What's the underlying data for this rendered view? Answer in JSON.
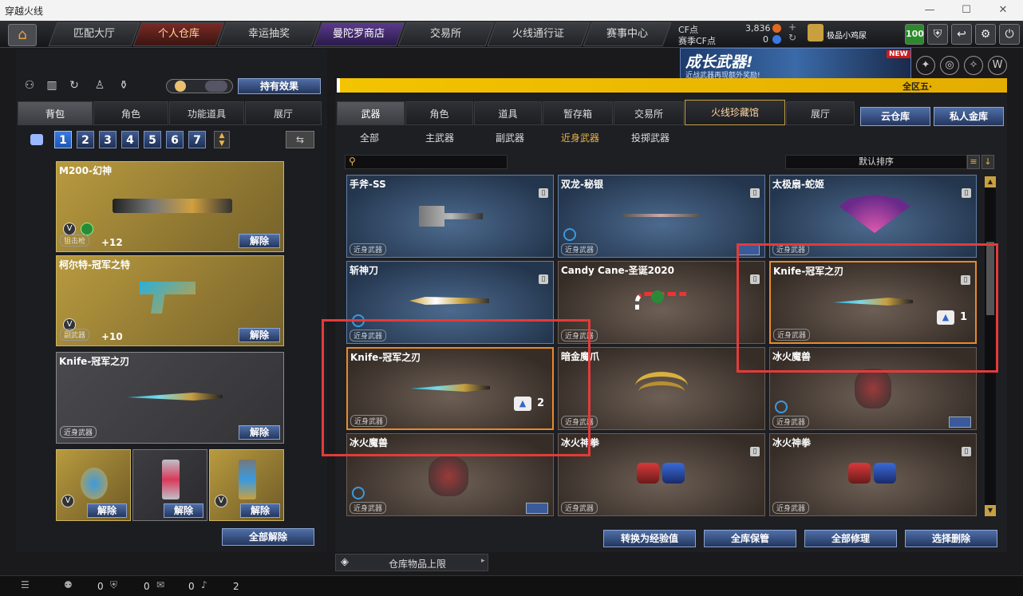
{
  "window": {
    "title": "穿越火线",
    "btn_min": "—",
    "btn_max": "☐",
    "btn_close": "✕"
  },
  "nav": {
    "items": [
      "匹配大厅",
      "个人仓库",
      "幸运抽奖",
      "曼陀罗商店",
      "交易所",
      "火线通行证",
      "赛事中心"
    ],
    "active": "个人仓库"
  },
  "currency": {
    "cf_label": "CF点",
    "cf_value": "3,836",
    "season_label": "赛季CF点",
    "season_value": "0"
  },
  "user": {
    "name": "极品小鸡尿",
    "level": "100"
  },
  "banner": {
    "title": "成长武器!",
    "sub": "近战武器再现额外奖励!",
    "new": "NEW"
  },
  "status_strip": {
    "text": "全区五·"
  },
  "left": {
    "effect_button": "持有效果",
    "tabs": [
      "背包",
      "角色",
      "功能道具",
      "展厅"
    ],
    "active_tab": "背包",
    "pages": [
      "1",
      "2",
      "3",
      "4",
      "5",
      "6",
      "7"
    ],
    "slots": [
      {
        "name": "M200-幻神",
        "category": "狙击枪",
        "bonus": "+12",
        "release": "解除"
      },
      {
        "name": "柯尔特-冠军之特",
        "category": "副武器",
        "bonus": "+10",
        "release": "解除"
      },
      {
        "name": "Knife-冠军之刃",
        "category": "近身武器",
        "release": "解除"
      }
    ],
    "small_slots": [
      {
        "release": "解除"
      },
      {
        "release": "解除"
      },
      {
        "release": "解除"
      }
    ],
    "release_all": "全部解除"
  },
  "right": {
    "tabs": [
      "武器",
      "角色",
      "道具",
      "暂存箱",
      "交易所",
      "火线珍藏馆",
      "展厅"
    ],
    "active_tab": "武器",
    "extra_tabs": [
      "云仓库",
      "私人金库"
    ],
    "subtabs": [
      "全部",
      "主武器",
      "副武器",
      "近身武器",
      "投掷武器"
    ],
    "active_subtab": "近身武器",
    "search_placeholder": "",
    "sort_label": "默认排序",
    "grid": [
      {
        "name": "手斧-SS",
        "category": "近身武器",
        "tone": "blue"
      },
      {
        "name": "双龙-秘银",
        "category": "近身武器",
        "tone": "blue",
        "trade": true,
        "check": true
      },
      {
        "name": "太极扇-蛇姬",
        "category": "近身武器",
        "tone": "blue"
      },
      {
        "name": "斩神刀",
        "category": "近身武器",
        "tone": "blue",
        "trade": true
      },
      {
        "name": "Candy Cane-圣诞2020",
        "category": "近身武器",
        "tone": "brown"
      },
      {
        "name": "Knife-冠军之刃",
        "category": "近身武器",
        "tone": "brown",
        "selected": true,
        "count": "1"
      },
      {
        "name": "Knife-冠军之刃",
        "category": "近身武器",
        "tone": "brown",
        "selected": true,
        "count": "2"
      },
      {
        "name": "暗金魔爪",
        "category": "近身武器",
        "tone": "brown"
      },
      {
        "name": "冰火魔兽",
        "category": "近身武器",
        "tone": "brown",
        "trade": true,
        "check": true
      },
      {
        "name": "冰火魔兽",
        "category": "近身武器",
        "tone": "brown",
        "trade": true,
        "check": true
      },
      {
        "name": "冰火神拳",
        "category": "近身武器",
        "tone": "brown"
      },
      {
        "name": "冰火神拳",
        "category": "近身武器",
        "tone": "brown"
      }
    ],
    "actions": [
      "转换为经验值",
      "全库保管",
      "全部修理",
      "选择删除"
    ],
    "storage_limit": "仓库物品上限"
  },
  "footer": {
    "v1": "0",
    "v2": "0",
    "v3": "0",
    "v4": "2"
  },
  "colors": {
    "accent_gold": "#e8b44a",
    "select_orange": "#e88a2a",
    "annotation_red": "#e33b3b"
  }
}
